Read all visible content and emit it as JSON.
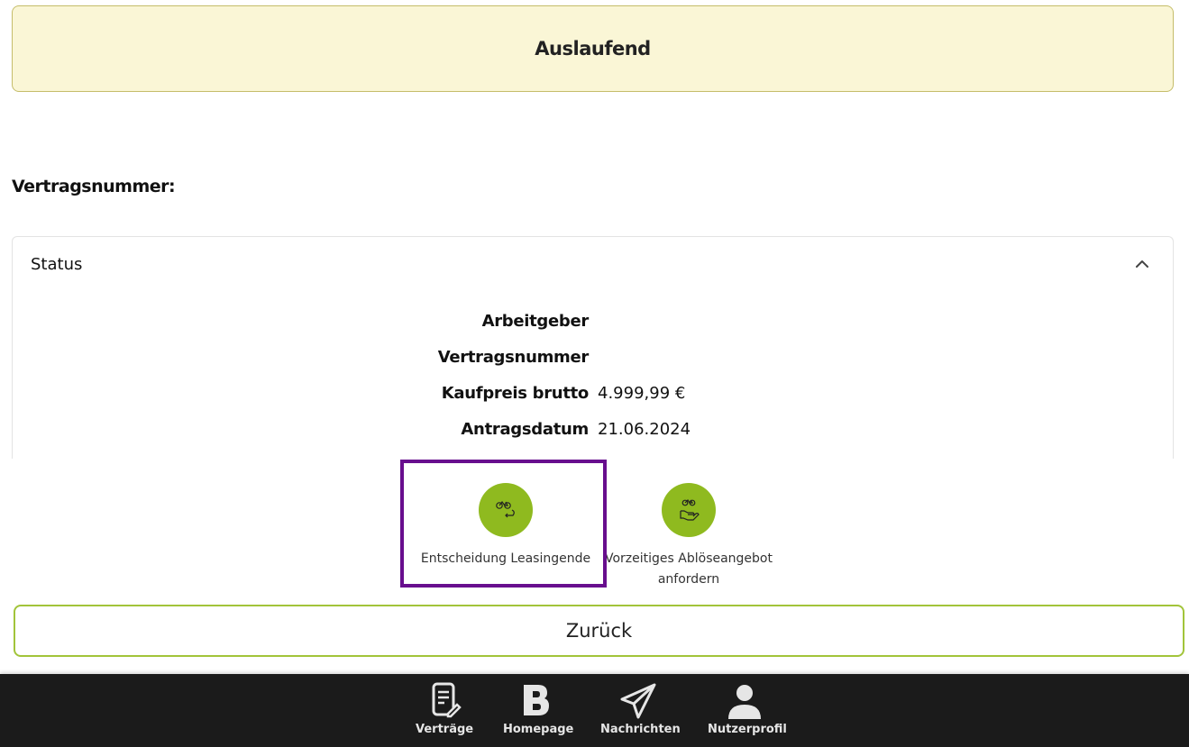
{
  "banner": {
    "status_label": "Auslaufend"
  },
  "contract": {
    "heading": "Vertragsnummer:"
  },
  "status_panel": {
    "title": "Status",
    "rows": [
      {
        "label": "Arbeitgeber",
        "value": ""
      },
      {
        "label": "Vertragsnummer",
        "value": ""
      },
      {
        "label": "Kaufpreis brutto",
        "value": "4.999,99 €"
      },
      {
        "label": "Antragsdatum",
        "value": "21.06.2024"
      }
    ]
  },
  "actions": [
    {
      "label": "Entscheidung Leasingende",
      "icon": "bike-return-icon"
    },
    {
      "label": "Vorzeitiges Ablöseangebot anfordern",
      "icon": "bike-hand-icon"
    }
  ],
  "back_button": {
    "label": "Zurück"
  },
  "nav": {
    "items": [
      {
        "label": "Verträge",
        "icon": "contract-edit-icon"
      },
      {
        "label": "Homepage",
        "icon": "brand-b-icon"
      },
      {
        "label": "Nachrichten",
        "icon": "paper-plane-icon"
      },
      {
        "label": "Nutzerprofil",
        "icon": "user-icon"
      }
    ]
  },
  "colors": {
    "banner_bg": "#faf6d6",
    "accent_green": "#8fba1f",
    "highlight_purple": "#680e8e",
    "nav_bg": "#1b1b1b"
  }
}
